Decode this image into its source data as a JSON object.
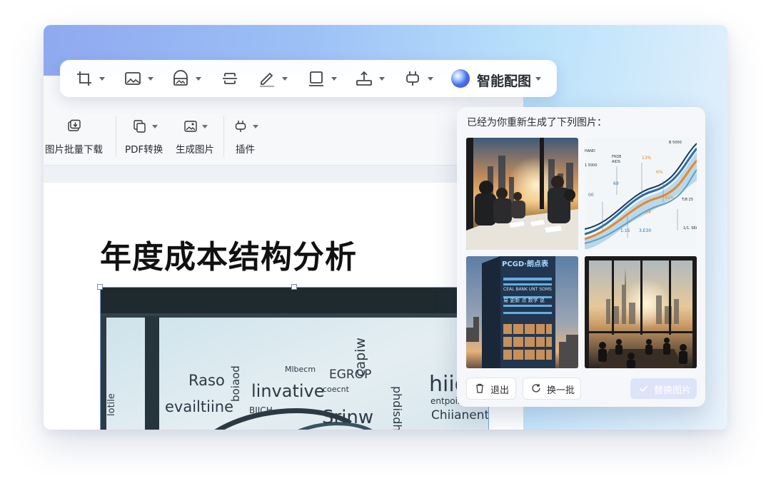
{
  "toolbar": {
    "icons": [
      "crop-icon",
      "image-icon",
      "replace-image-icon",
      "align-icon",
      "edit-icon",
      "frame-icon",
      "upload-icon",
      "plugin-icon"
    ],
    "ai_label": "智能配图"
  },
  "ribbon": {
    "groups": [
      {
        "label": "图片批量下载",
        "icon": "batch-download-icon"
      },
      {
        "label": "PDF转换",
        "icon": "pdf-convert-icon"
      },
      {
        "label": "生成图片",
        "icon": "generate-image-icon"
      },
      {
        "label": "插件",
        "icon": "plugin-icon"
      }
    ]
  },
  "document": {
    "title": "年度成本结构分析",
    "wordcloud": [
      "Raso",
      "linvative",
      "evailtiine",
      "Srinw",
      "hiid",
      "Chiianent",
      "EGROP",
      "capiw",
      "Mlbecm",
      "BIICH",
      "coecnt",
      "entpoinr",
      "lotile",
      "phdisdh",
      "boiaod"
    ]
  },
  "panel": {
    "title": "已经为你重新生成了下列图片：",
    "images": [
      "meeting-sunset-photo",
      "wave-infographic",
      "tower-building-photo",
      "skyline-office-photo"
    ],
    "tower_sign_1": "PCGD·朗点表",
    "tower_sign_2": "CEAL BANK UNT SOMS",
    "tower_sign_3": "易 更新 点 数字 说",
    "exit_label": "退出",
    "refresh_label": "换一批",
    "replace_label": "替换图片"
  },
  "colors": {
    "accent": "#3f6fe8",
    "primary_disabled": "#dde4fa"
  }
}
